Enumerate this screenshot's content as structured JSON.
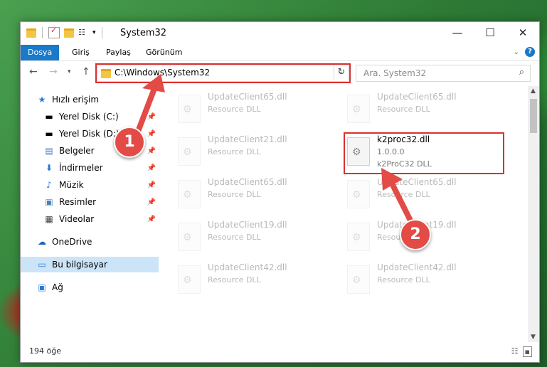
{
  "window": {
    "title": "System32"
  },
  "ribbon": {
    "tabs": [
      "Dosya",
      "Giriş",
      "Paylaş",
      "Görünüm"
    ]
  },
  "address": {
    "path": "C:\\Windows\\System32"
  },
  "search": {
    "placeholder": "Ara. System32"
  },
  "sidebar": {
    "items": [
      {
        "label": "Hızlı erişim",
        "icon": "star-icon"
      },
      {
        "label": "Yerel Disk (C:)",
        "icon": "drive-icon"
      },
      {
        "label": "Yerel Disk (D:)",
        "icon": "drive-icon"
      },
      {
        "label": "Belgeler",
        "icon": "document-icon"
      },
      {
        "label": "İndirmeler",
        "icon": "download-icon"
      },
      {
        "label": "Müzik",
        "icon": "music-icon"
      },
      {
        "label": "Resimler",
        "icon": "pictures-icon"
      },
      {
        "label": "Videolar",
        "icon": "video-icon"
      },
      {
        "label": "OneDrive",
        "icon": "cloud-icon"
      },
      {
        "label": "Bu bilgisayar",
        "icon": "computer-icon"
      },
      {
        "label": "Ağ",
        "icon": "network-icon"
      }
    ]
  },
  "files": [
    {
      "name": "UpdateClient65.dll",
      "desc": "Resource DLL"
    },
    {
      "name": "UpdateClient65.dll",
      "desc": "Resource DLL"
    },
    {
      "name": "UpdateClient21.dll",
      "desc": "Resource DLL"
    },
    {
      "name": "k2proc32.dll",
      "version": "1.0.0.0",
      "desc": "k2ProC32 DLL"
    },
    {
      "name": "UpdateClient65.dll",
      "desc": "Resource DLL"
    },
    {
      "name": "UpdateClient65.dll",
      "desc": "Resource DLL"
    },
    {
      "name": "UpdateClient19.dll",
      "desc": "Resource DLL"
    },
    {
      "name": "UpdateClient19.dll",
      "desc": "Resource DLL"
    },
    {
      "name": "UpdateClient42.dll",
      "desc": "Resource DLL"
    },
    {
      "name": "UpdateClient42.dll",
      "desc": "Resource DLL"
    }
  ],
  "status": {
    "count": "194 öğe"
  },
  "callouts": [
    "1",
    "2"
  ],
  "colors": {
    "accent": "#1979ca",
    "highlight": "#d9312f",
    "callout": "#e24b46"
  }
}
